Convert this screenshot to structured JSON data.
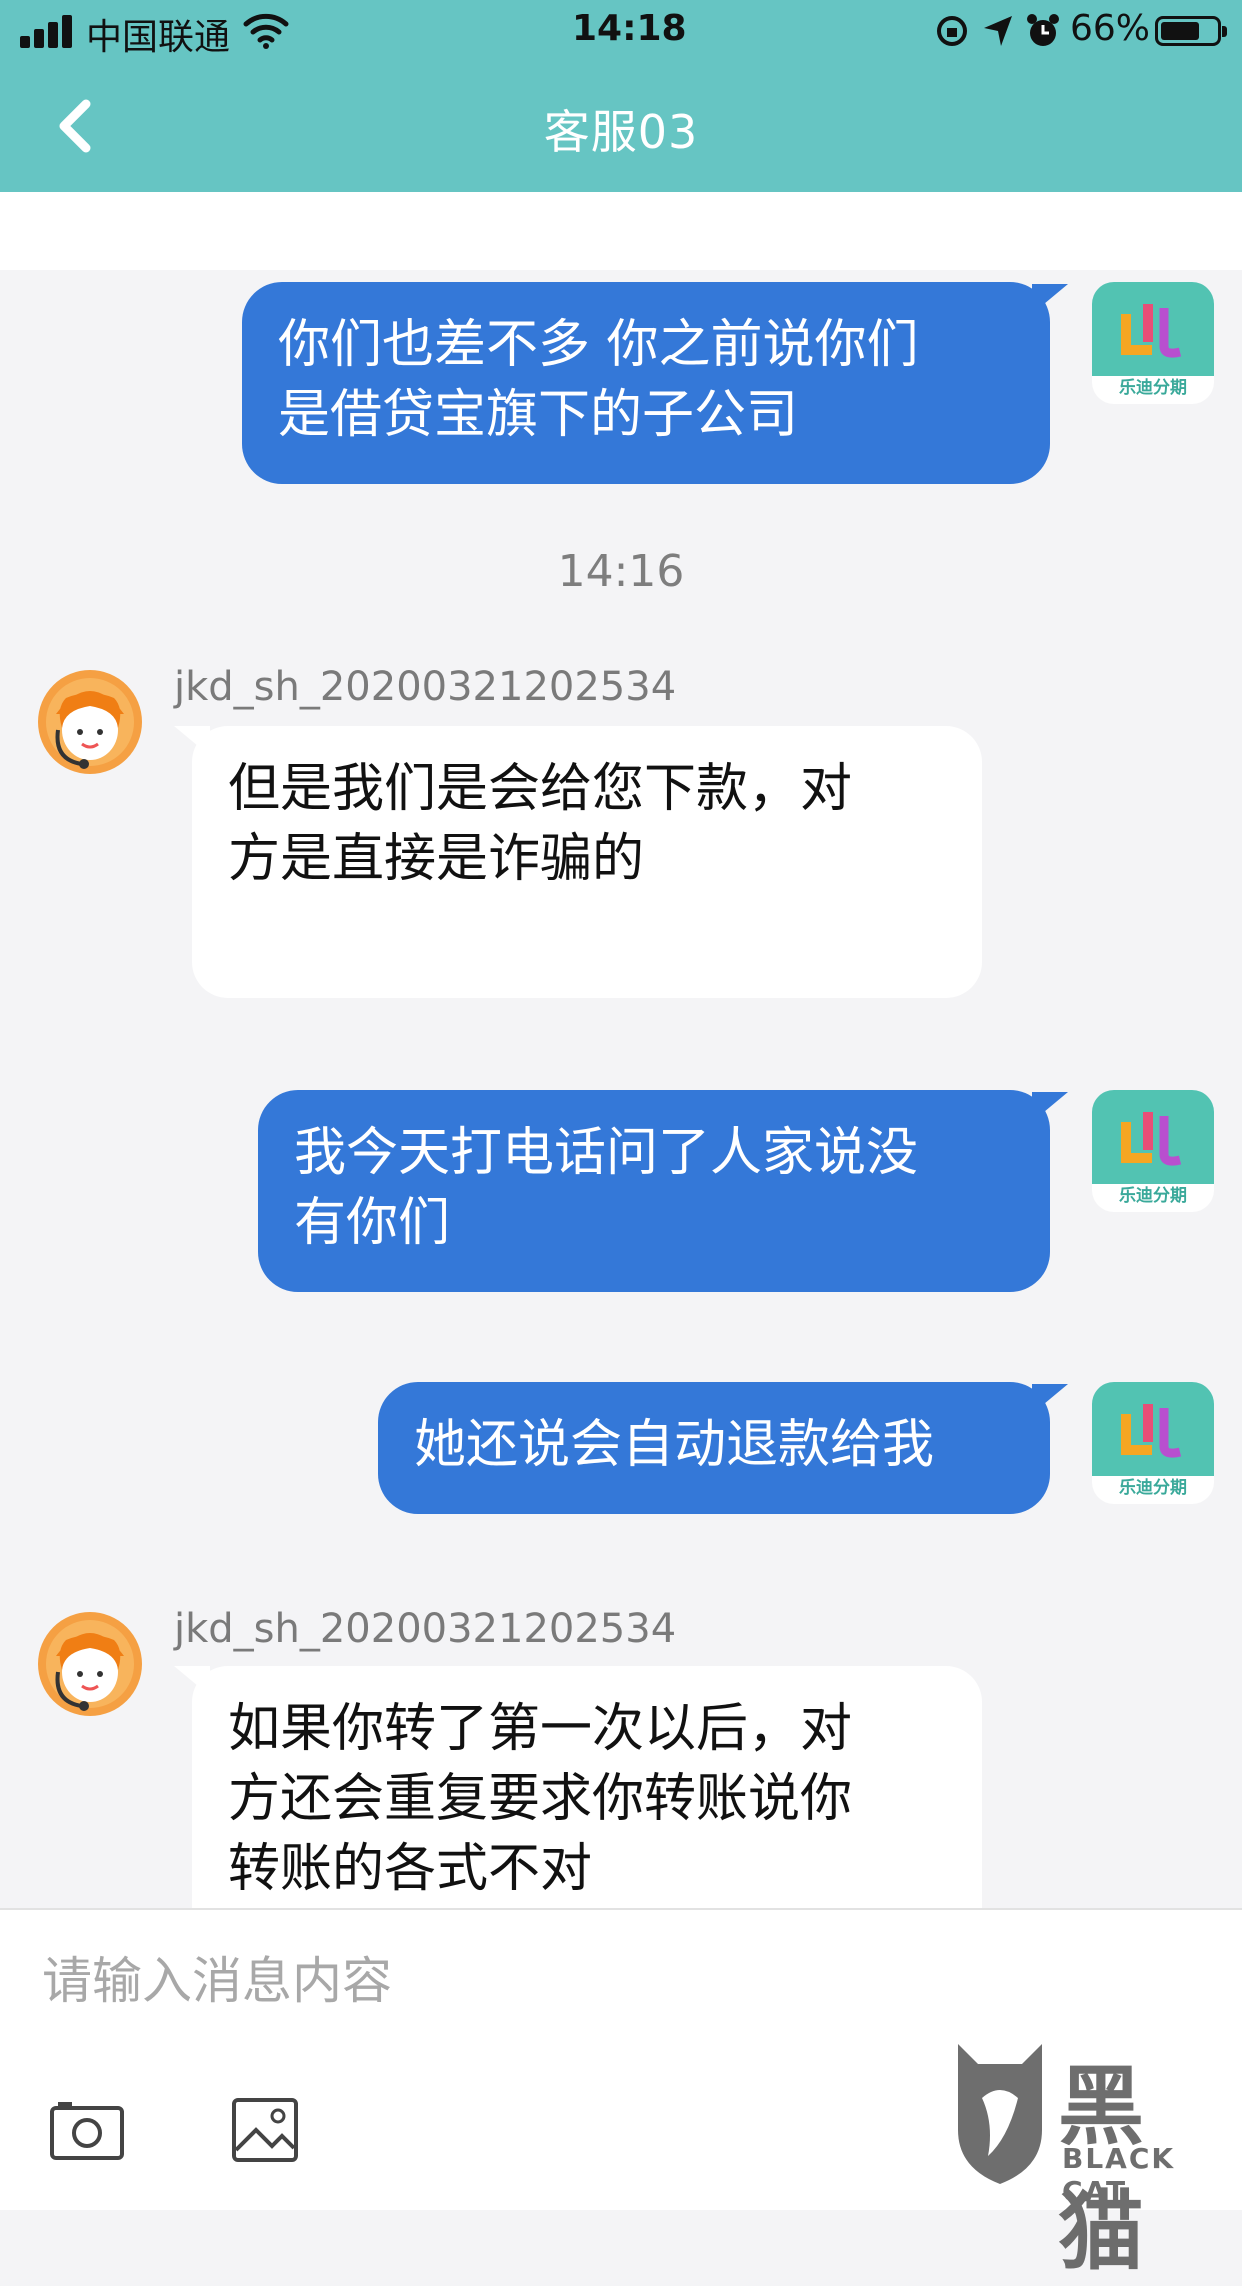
{
  "status_bar": {
    "carrier": "中国联通",
    "time": "14:18",
    "battery": "66%"
  },
  "header": {
    "title": "客服03"
  },
  "app_avatar_caption": "乐迪分期",
  "messages": [
    {
      "from": "me",
      "text": "你们也差不多 你之前说你们\n是借贷宝旗下的子公司"
    },
    {
      "from": "agent",
      "sender": "jkd_sh_20200321202534",
      "text": "但是我们是会给您下款，对\n方是直接是诈骗的\n"
    },
    {
      "from": "me",
      "text": "我今天打电话问了人家说没\n有你们"
    },
    {
      "from": "me",
      "text": "她还说会自动退款给我"
    },
    {
      "from": "agent",
      "sender": "jkd_sh_20200321202534",
      "text": "如果你转了第一次以后，对\n方还会重复要求你转账说你\n转账的各式不对"
    }
  ],
  "timestamp": "14:16",
  "composer": {
    "placeholder": "请输入消息内容"
  },
  "watermark": {
    "text": "黑猫",
    "subtext": "BLACK CAT"
  },
  "colors": {
    "header": "#66c5c3",
    "outgoing_bubble": "#3478d8",
    "background": "#f4f4f6"
  }
}
